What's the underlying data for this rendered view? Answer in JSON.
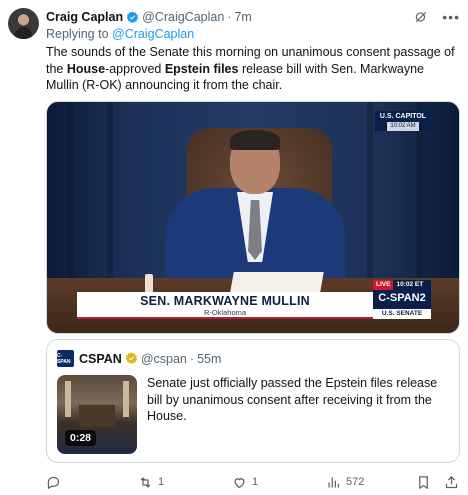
{
  "tweet": {
    "author_name": "Craig Caplan",
    "author_handle": "@CraigCaplan",
    "separator": "·",
    "time": "7m",
    "replying_prefix": "Replying to ",
    "replying_to": "@CraigCaplan",
    "text_part1": "The sounds of the Senate this morning on unanimous consent passage of the ",
    "text_bold1": "House",
    "text_part2": "-approved ",
    "text_bold2": "Epstein files",
    "text_part3": " release bill with Sen. Markwayne Mullin (R-OK) announcing it from the chair."
  },
  "video": {
    "capitol_label": "U.S. CAPITOL",
    "capitol_time": "10:02 AM",
    "lower_third_name": "SEN. MARKWAYNE MULLIN",
    "lower_third_sub": "R-Oklahoma",
    "live_label": "LIVE",
    "live_time": "10:02 ET",
    "network_logo": "C-SPAN2",
    "network_sub": "U.S. SENATE"
  },
  "quote": {
    "logo_text": "C-SPAN",
    "name": "CSPAN",
    "handle": "@cspan",
    "separator": "·",
    "time": "55m",
    "text": "Senate just officially passed the Epstein files release bill by unanimous consent after receiving it from the House.",
    "duration": "0:28"
  },
  "actions": {
    "reply_count": "",
    "retweet_count": "1",
    "like_count": "1",
    "views_count": "572"
  },
  "colors": {
    "accent": "#1d9bf0",
    "secondary_text": "#536471",
    "border": "#cfd9de",
    "cspan_navy": "#0a1f4a",
    "gold_badge": "#e2b719"
  },
  "icons": [
    "verified-badge-icon",
    "grok-icon",
    "more-icon",
    "gold-verified-icon",
    "reply-icon",
    "retweet-icon",
    "like-icon",
    "views-icon",
    "bookmark-icon",
    "share-icon"
  ]
}
